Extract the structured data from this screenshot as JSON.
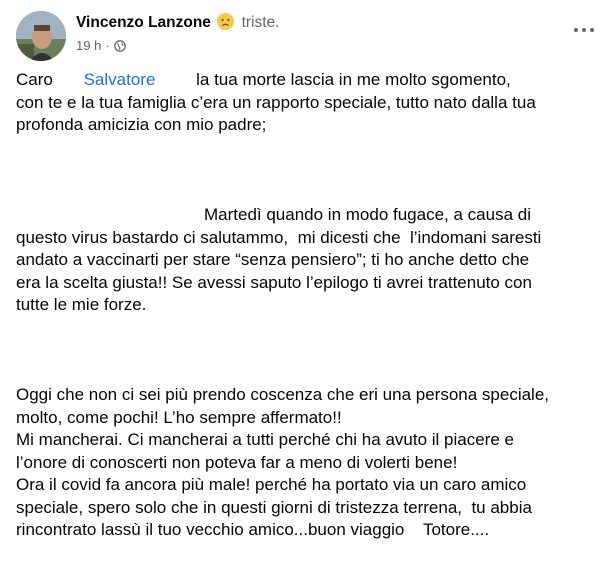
{
  "post": {
    "author": "Vincenzo Lanzone",
    "feeling_icon": "sad-face-emoji",
    "feeling": "triste.",
    "time": "19 h",
    "separator": "·",
    "audience_icon": "globe-icon",
    "more_icon": "more-options-icon",
    "text": {
      "p1_l1_a": "Caro ",
      "p1_tag": "Salvatore",
      "p1_l1_b": " la tua morte lascia in me molto sgomento,",
      "p1_l2": "con te e la tua famiglia c’era un rapporto speciale, tutto nato dalla tua",
      "p1_l3": "profonda amicizia con mio padre;",
      "p2_l1": "Martedì quando in modo fugace, a causa di",
      "p2_l2": "questo virus bastardo ci salutammo,  mi dicesti che  l’indomani saresti",
      "p2_l3": "andato a vaccinarti per stare “senza pensiero”; ti ho anche detto che",
      "p2_l4": "era la scelta giusta!! Se avessi saputo l’epilogo ti avrei trattenuto con",
      "p2_l5": "tutte le mie forze.",
      "p3_l1": "Oggi che non ci sei più prendo coscenza che eri una persona speciale,",
      "p3_l2": "molto, come pochi! L’ho sempre affermato!!",
      "p3_l3": "Mi mancherai. Ci mancherai a tutti perché chi ha avuto il piacere e",
      "p3_l4": "l’onore di conoscerti non poteva far a meno di volerti bene!",
      "p3_l5": "Ora il covid fa ancora più male! perché ha portato via un caro amico",
      "p3_l6": "speciale, spero solo che in questi giorni di tristezza terrena,  tu abbia",
      "p3_l7": "rincontrato lassù il tuo vecchio amico...buon viaggio    Totore...."
    }
  }
}
